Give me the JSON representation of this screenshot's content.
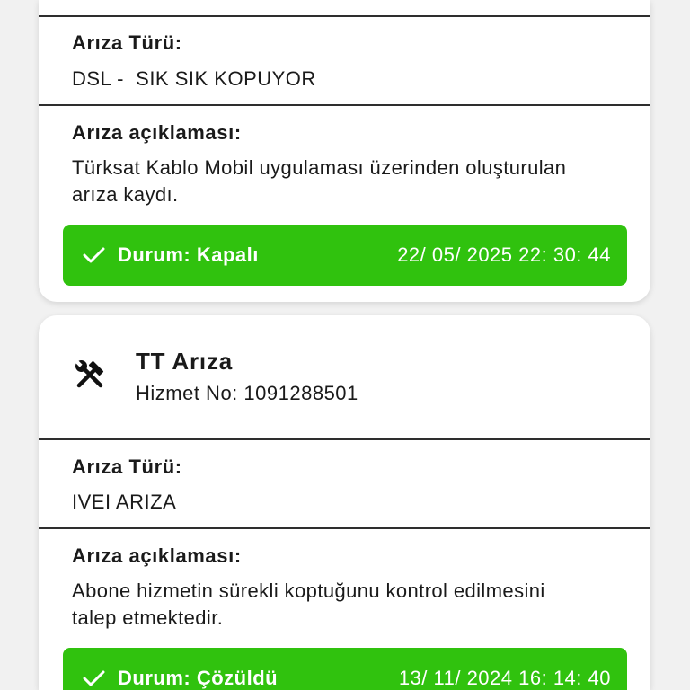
{
  "theme": {
    "background": "#f1f1f1",
    "card": "#ffffff",
    "text": "#1a1a1a",
    "divider": "#2e2e2e",
    "status_green": "#30c20e",
    "status_text": "#ffffff"
  },
  "cards": [
    {
      "fault_type": {
        "label": "Arıza Türü:",
        "value": "DSL -  SIK SIK KOPUYOR"
      },
      "description": {
        "label": "Arıza açıklaması:",
        "text": "Türksat Kablo Mobil uygulaması üzerinden oluşturulan arıza kaydı."
      },
      "status": {
        "icon": "check-icon",
        "label": "Durum:",
        "value": "Kapalı",
        "datetime": "22/ 05/ 2025 22: 30: 44"
      }
    },
    {
      "icon": "tools-icon",
      "title": "TT Arıza",
      "service": {
        "label": "Hizmet No:",
        "value": "1091288501"
      },
      "fault_type": {
        "label": "Arıza Türü:",
        "value": "IVEI ARIZA"
      },
      "description": {
        "label": "Arıza açıklaması:",
        "text": "Abone hizmetin sürekli koptuğunu kontrol edilmesini talep etmektedir."
      },
      "status": {
        "icon": "check-icon",
        "label": "Durum:",
        "value": "Çözüldü",
        "datetime": "13/ 11/ 2024 16: 14: 40"
      }
    }
  ]
}
